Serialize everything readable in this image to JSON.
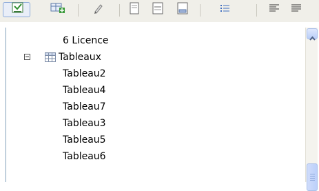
{
  "toolbar": {
    "items": [
      {
        "name": "check-list-icon",
        "active": true
      },
      {
        "name": "add-table-icon",
        "active": false
      },
      {
        "name": "edit-icon",
        "active": false
      },
      {
        "name": "page-icon",
        "active": false
      },
      {
        "name": "page-lines-icon",
        "active": false
      },
      {
        "name": "page-header-icon",
        "active": false
      },
      {
        "name": "list-icon",
        "active": false
      },
      {
        "name": "align-left-icon",
        "active": false
      },
      {
        "name": "align-justify-icon",
        "active": false
      }
    ]
  },
  "tree": {
    "items": [
      {
        "label": "6 Licence"
      },
      {
        "label": "Tableaux",
        "expanded": true,
        "icon": "table-icon",
        "expander_symbol": "minus"
      },
      {
        "label": "Tableau2"
      },
      {
        "label": "Tableau4"
      },
      {
        "label": "Tableau7"
      },
      {
        "label": "Tableau3"
      },
      {
        "label": "Tableau5"
      },
      {
        "label": "Tableau6"
      }
    ]
  },
  "scrollbar": {
    "position": 0.85
  },
  "colors": {
    "border": "#7f9db9",
    "toolbar_bg": "#f0efe9",
    "scroll_thumb": "#c3d3fd"
  }
}
